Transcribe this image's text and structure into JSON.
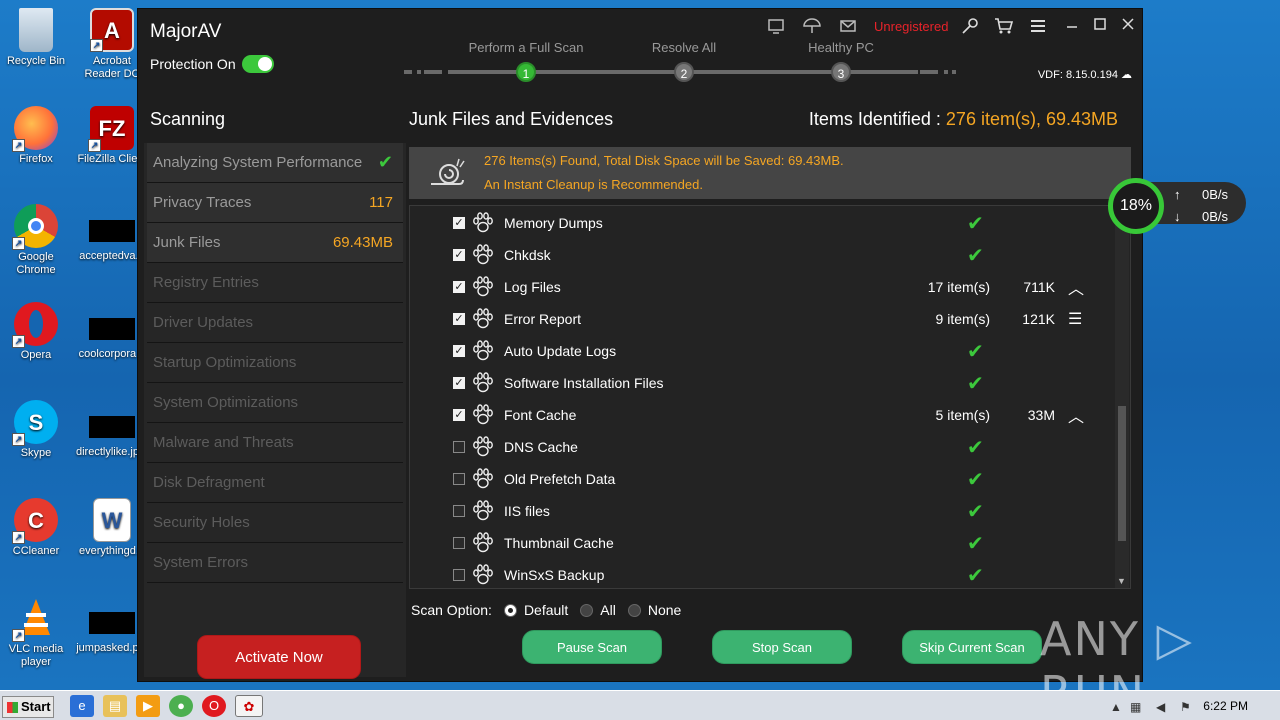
{
  "desktop": {
    "icons": [
      {
        "label": "Recycle Bin"
      },
      {
        "label": "Acrobat Reader DC"
      },
      {
        "label": "Firefox"
      },
      {
        "label": "FileZilla Client"
      },
      {
        "label": "Google Chrome"
      },
      {
        "label": "acceptedva..."
      },
      {
        "label": "Opera"
      },
      {
        "label": "coolcorpora..."
      },
      {
        "label": "Skype"
      },
      {
        "label": "directlylike.jp..."
      },
      {
        "label": "CCleaner"
      },
      {
        "label": "everythingd..."
      },
      {
        "label": "VLC media player"
      },
      {
        "label": "jumpasked.p..."
      }
    ]
  },
  "app": {
    "title": "MajorAV",
    "protection_label": "Protection On",
    "protection_on": true,
    "unregistered": "Unregistered",
    "vdf": "VDF: 8.15.0.194",
    "steps": [
      {
        "label": "Perform a Full Scan",
        "num": "1",
        "active": true
      },
      {
        "label": "Resolve All",
        "num": "2",
        "active": false
      },
      {
        "label": "Healthy PC",
        "num": "3",
        "active": false
      }
    ],
    "colors": {
      "accent_green": "#3cc83c",
      "accent_orange": "#f5a623",
      "danger_red": "#c62020",
      "unregistered_red": "#e8232a"
    }
  },
  "sidebar": {
    "heading": "Scanning",
    "items": [
      {
        "label": "Analyzing System Performance",
        "value": "",
        "check": "✔"
      },
      {
        "label": "Privacy Traces",
        "value": "117",
        "check": ""
      },
      {
        "label": "Junk Files",
        "value": "69.43MB",
        "check": ""
      },
      {
        "label": "Registry Entries",
        "value": "",
        "check": ""
      },
      {
        "label": "Driver Updates",
        "value": "",
        "check": ""
      },
      {
        "label": "Startup Optimizations",
        "value": "",
        "check": ""
      },
      {
        "label": "System Optimizations",
        "value": "",
        "check": ""
      },
      {
        "label": "Malware and Threats",
        "value": "",
        "check": ""
      },
      {
        "label": "Disk Defragment",
        "value": "",
        "check": ""
      },
      {
        "label": "Security Holes",
        "value": "",
        "check": ""
      },
      {
        "label": "System Errors",
        "value": "",
        "check": ""
      }
    ],
    "activate_label": "Activate Now"
  },
  "main": {
    "heading": "Junk Files and Evidences",
    "items_label": "Items Identified : ",
    "items_value": "276 item(s), 69.43MB",
    "banner_line1": "276 Items(s) Found, Total Disk Space will be Saved: 69.43MB.",
    "banner_line2": "An Instant Cleanup is Recommended.",
    "rows": [
      {
        "name": "Memory Dumps",
        "checked": true,
        "count": "",
        "size": "",
        "ok": true,
        "action": ""
      },
      {
        "name": "Chkdsk",
        "checked": true,
        "count": "",
        "size": "",
        "ok": true,
        "action": ""
      },
      {
        "name": "Log Files",
        "checked": true,
        "count": "17 item(s)",
        "size": "711K",
        "ok": false,
        "action": "chevron-up"
      },
      {
        "name": "Error Report",
        "checked": true,
        "count": "9 item(s)",
        "size": "121K",
        "ok": false,
        "action": "list"
      },
      {
        "name": "Auto Update Logs",
        "checked": true,
        "count": "",
        "size": "",
        "ok": true,
        "action": ""
      },
      {
        "name": "Software Installation Files",
        "checked": true,
        "count": "",
        "size": "",
        "ok": true,
        "action": ""
      },
      {
        "name": "Font Cache",
        "checked": true,
        "count": "5 item(s)",
        "size": "33M",
        "ok": false,
        "action": "chevron-up"
      },
      {
        "name": "DNS Cache",
        "checked": false,
        "count": "",
        "size": "",
        "ok": true,
        "action": ""
      },
      {
        "name": "Old Prefetch Data",
        "checked": false,
        "count": "",
        "size": "",
        "ok": true,
        "action": ""
      },
      {
        "name": "IIS files",
        "checked": false,
        "count": "",
        "size": "",
        "ok": true,
        "action": ""
      },
      {
        "name": "Thumbnail Cache",
        "checked": false,
        "count": "",
        "size": "",
        "ok": true,
        "action": ""
      },
      {
        "name": "WinSxS Backup",
        "checked": false,
        "count": "",
        "size": "",
        "ok": true,
        "action": ""
      }
    ],
    "scan_option_label": "Scan Option:",
    "scan_options": [
      {
        "label": "Default",
        "selected": true
      },
      {
        "label": "All",
        "selected": false
      },
      {
        "label": "None",
        "selected": false
      }
    ],
    "buttons": {
      "pause": "Pause Scan",
      "stop": "Stop Scan",
      "skip": "Skip Current Scan"
    }
  },
  "net_widget": {
    "percent": "18%",
    "up": "0B/s",
    "down": "0B/s",
    "up_arrow": "↑",
    "down_arrow": "↓"
  },
  "watermark": "ANY ▷ RUN",
  "taskbar": {
    "start_label": "Start",
    "clock": "6:22 PM"
  }
}
